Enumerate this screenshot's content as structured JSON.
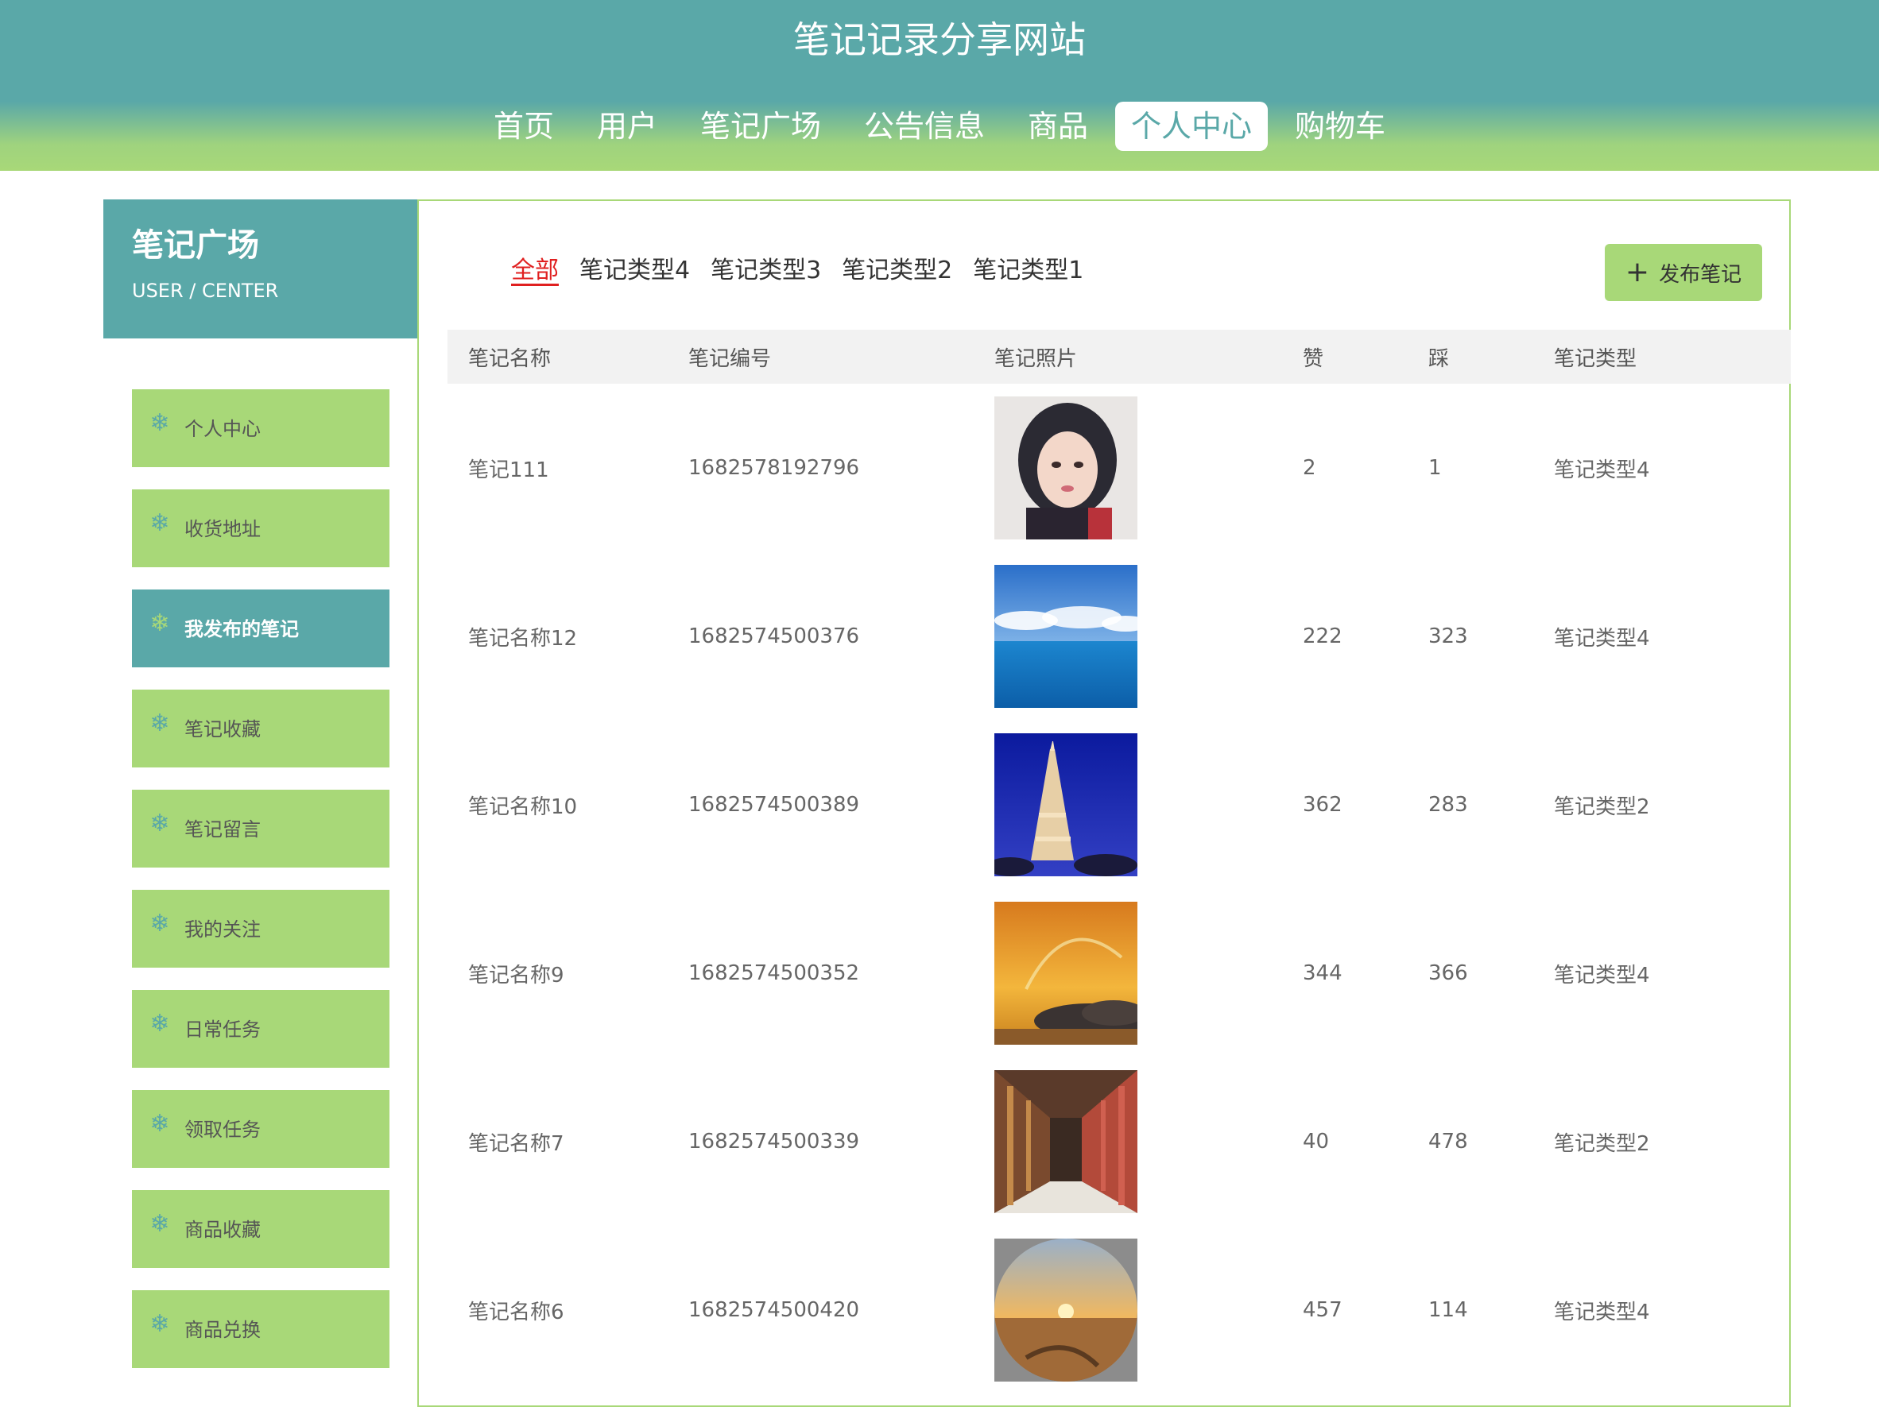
{
  "site": {
    "title": "笔记记录分享网站"
  },
  "nav": {
    "items": [
      {
        "label": "首页"
      },
      {
        "label": "用户"
      },
      {
        "label": "笔记广场"
      },
      {
        "label": "公告信息"
      },
      {
        "label": "商品"
      },
      {
        "label": "个人中心",
        "active": true
      },
      {
        "label": "购物车"
      }
    ]
  },
  "sidebar": {
    "title": "笔记广场",
    "subtitle": "USER / CENTER",
    "items": [
      {
        "label": "个人中心",
        "icon": "snowflake-icon"
      },
      {
        "label": "收货地址",
        "icon": "snowflake-icon"
      },
      {
        "label": "我发布的笔记",
        "icon": "snowflake-icon",
        "active": true
      },
      {
        "label": "笔记收藏",
        "icon": "snowflake-icon"
      },
      {
        "label": "笔记留言",
        "icon": "snowflake-icon"
      },
      {
        "label": "我的关注",
        "icon": "snowflake-icon"
      },
      {
        "label": "日常任务",
        "icon": "snowflake-icon"
      },
      {
        "label": "领取任务",
        "icon": "snowflake-icon"
      },
      {
        "label": "商品收藏",
        "icon": "snowflake-icon"
      },
      {
        "label": "商品兑换",
        "icon": "snowflake-icon"
      }
    ]
  },
  "filters": {
    "tabs": [
      {
        "label": "全部",
        "active": true
      },
      {
        "label": "笔记类型4"
      },
      {
        "label": "笔记类型3"
      },
      {
        "label": "笔记类型2"
      },
      {
        "label": "笔记类型1"
      }
    ],
    "publish_label": "发布笔记"
  },
  "table": {
    "headers": {
      "name": "笔记名称",
      "no": "笔记编号",
      "photo": "笔记照片",
      "like": "赞",
      "dislike": "踩",
      "type": "笔记类型"
    },
    "rows": [
      {
        "name": "笔记111",
        "no": "1682578192796",
        "photo": "portrait-photo",
        "like": "2",
        "dislike": "1",
        "type": "笔记类型4"
      },
      {
        "name": "笔记名称12",
        "no": "1682574500376",
        "photo": "sea-sky-photo",
        "like": "222",
        "dislike": "323",
        "type": "笔记类型4"
      },
      {
        "name": "笔记名称10",
        "no": "1682574500389",
        "photo": "eiffel-tower-photo",
        "like": "362",
        "dislike": "283",
        "type": "笔记类型2"
      },
      {
        "name": "笔记名称9",
        "no": "1682574500352",
        "photo": "sunset-rainbow-photo",
        "like": "344",
        "dislike": "366",
        "type": "笔记类型4"
      },
      {
        "name": "笔记名称7",
        "no": "1682574500339",
        "photo": "corridor-photo",
        "like": "40",
        "dislike": "478",
        "type": "笔记类型2"
      },
      {
        "name": "笔记名称6",
        "no": "1682574500420",
        "photo": "desert-sunset-photo",
        "like": "457",
        "dislike": "114",
        "type": "笔记类型4"
      }
    ]
  },
  "colors": {
    "teal": "#5aa8a8",
    "green": "#a8d878",
    "active_tab": "#e02020"
  }
}
